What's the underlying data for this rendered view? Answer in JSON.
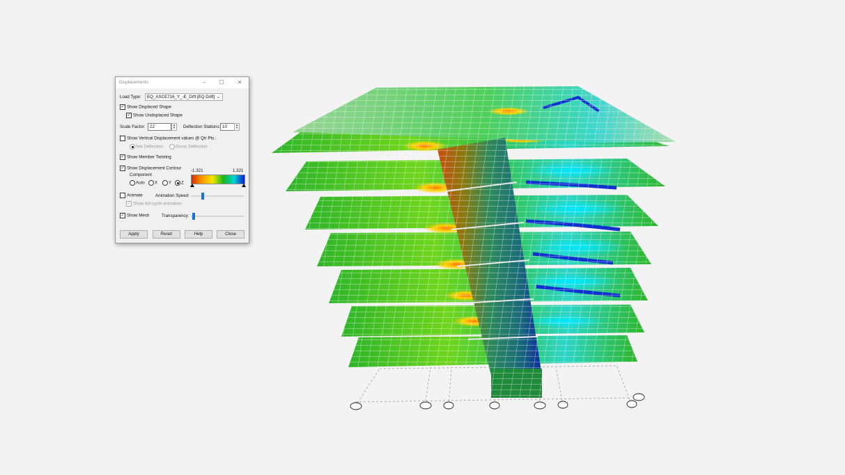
{
  "dialog": {
    "title": "Displacements",
    "load_type_label": "Load Type:",
    "load_type_value": "EQ_ASCE716_Y_-E_Drft [EQ Drift]",
    "show_displaced_shape": "Show Displaced Shape",
    "show_undisplaced_shape": "Show Undisplaced Shape",
    "scale_factor_label": "Scale Factor:",
    "scale_factor_value": "22",
    "deflection_stations_label": "Deflection Stations:",
    "deflection_stations_value": "10",
    "show_vertical_displacement": "Show Vertical Displacement values @ Qtr Pts.:",
    "net_deflection": "Net Deflection",
    "gross_deflection": "Gross Deflection",
    "show_member_twisting": "Show Member Twisting",
    "show_displacement_contour": "Show Displacement Contour",
    "component_label": "Component",
    "component_options": [
      "Auto",
      "X",
      "Y",
      "Z"
    ],
    "contour_min": "-1.321",
    "contour_max": "1.321",
    "animate": "Animate",
    "animation_speed_label": "Animation Speed:",
    "animation_speed_level": 0.2,
    "show_full_cycle": "Show full-cycle animation",
    "show_mesh": "Show Mesh",
    "transparency_label": "Transparency:",
    "transparency_level": 0.03,
    "buttons": {
      "apply": "Apply",
      "reset": "Reset",
      "help": "Help",
      "close": "Close"
    },
    "checked": {
      "displaced": true,
      "undisplaced": true,
      "vertical": false,
      "twisting": true,
      "contour": true,
      "animate": false,
      "full_cycle": true,
      "mesh": true
    },
    "selected_component": "Z"
  },
  "colors": {
    "contour_stops": [
      "#d42a00",
      "#ff9a00",
      "#f2e600",
      "#19b619",
      "#00d6d6",
      "#0a1ed2"
    ],
    "accent": "#1a73d8",
    "mesh_line": "#ffffff"
  }
}
